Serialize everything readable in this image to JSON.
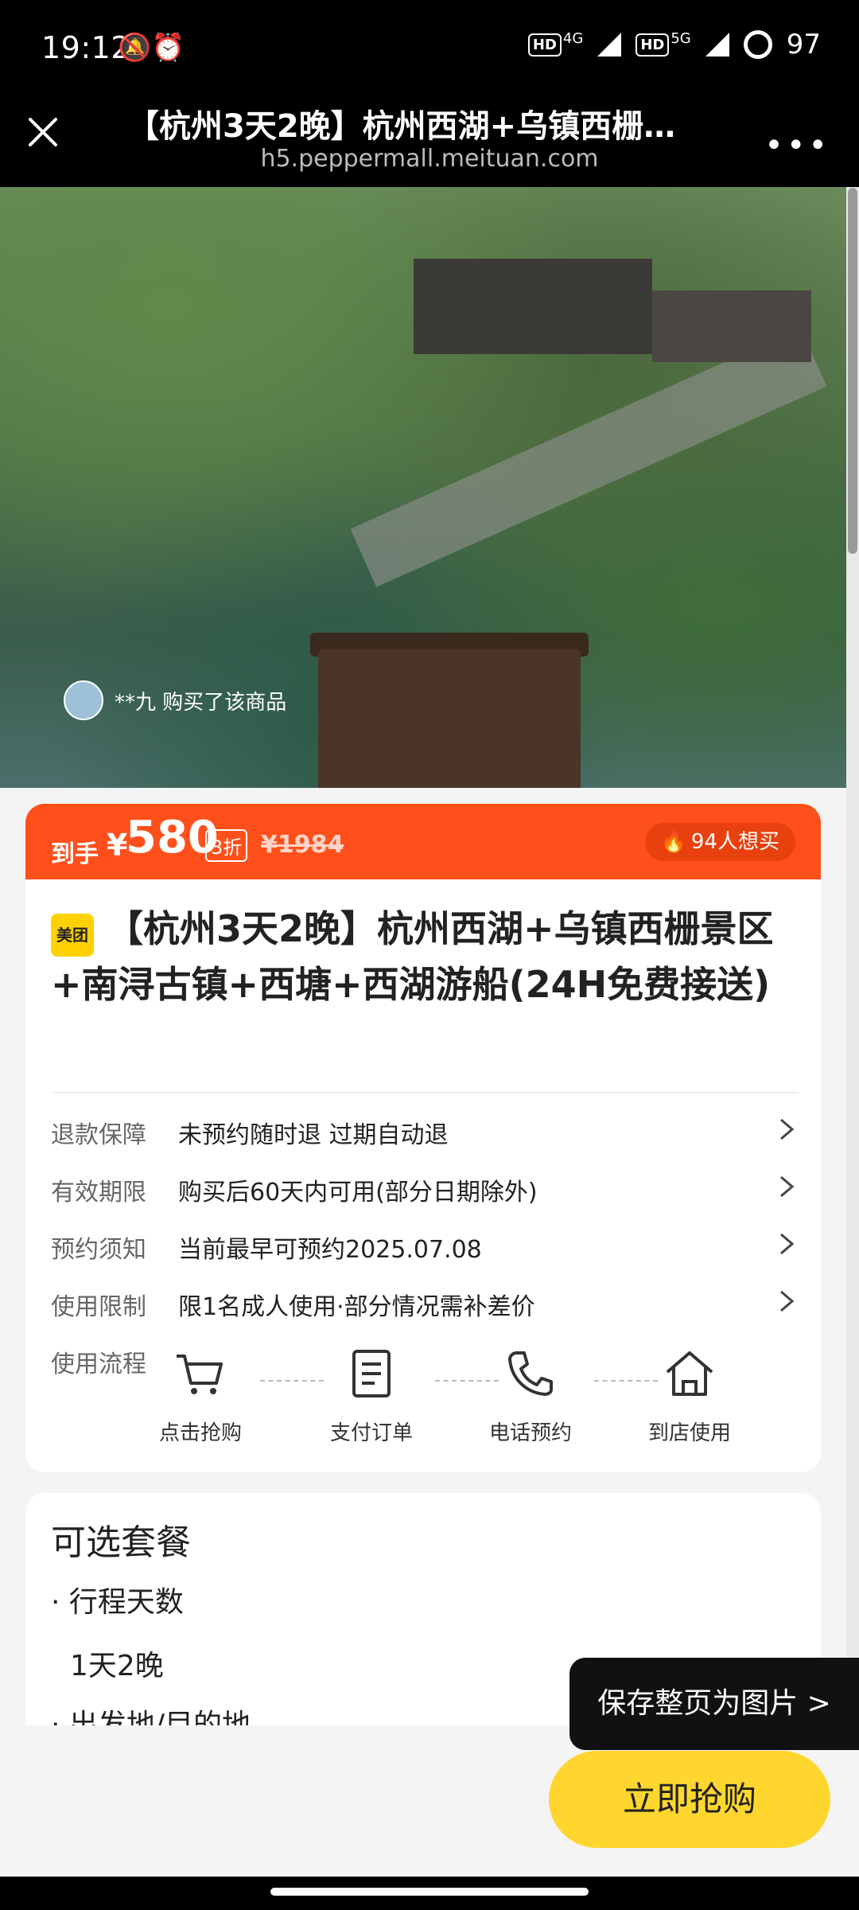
{
  "status_bar": {
    "time": "19:12",
    "left_icons": "🔕⏰",
    "net1": "HD",
    "net1_gen": "4G",
    "net2": "HD",
    "net2_gen": "5G",
    "battery": "97"
  },
  "title_bar": {
    "title": "【杭州3天2晚】杭州西湖+乌镇西栅…",
    "url": "h5.peppermall.meituan.com",
    "more_icon": "•••"
  },
  "hero": {
    "buyer_text": "**九 购买了该商品"
  },
  "price_bar": {
    "label": "到手",
    "currency": "¥",
    "price": "580",
    "discount": "3折",
    "original": "¥1984",
    "want": "94人想买"
  },
  "product": {
    "logo": "美团",
    "title": "【杭州3天2晚】杭州西湖+乌镇西栅景区+南浔古镇+西塘+西湖游船(24H免费接送)"
  },
  "info_rows": [
    {
      "key": "退款保障",
      "value": "未预约随时退 过期自动退"
    },
    {
      "key": "有效期限",
      "value": "购买后60天内可用(部分日期除外)"
    },
    {
      "key": "预约须知",
      "value": "当前最早可预约2025.07.08"
    },
    {
      "key": "使用限制",
      "value": "限1名成人使用·部分情况需补差价"
    }
  ],
  "flow": {
    "label": "使用流程",
    "steps": [
      "点击抢购",
      "支付订单",
      "电话预约",
      "到店使用"
    ]
  },
  "packages": {
    "title": "可选套餐",
    "bullet1": "· 行程天数",
    "value1": "1天2晚",
    "bullet2": "· 出发地/目的地"
  },
  "actions": {
    "save_page": "保存整页为图片 >",
    "buy_now": "立即抢购"
  },
  "colors": {
    "accent": "#ff4f1a",
    "buy": "#ffd62e",
    "logo": "#ffd100"
  }
}
